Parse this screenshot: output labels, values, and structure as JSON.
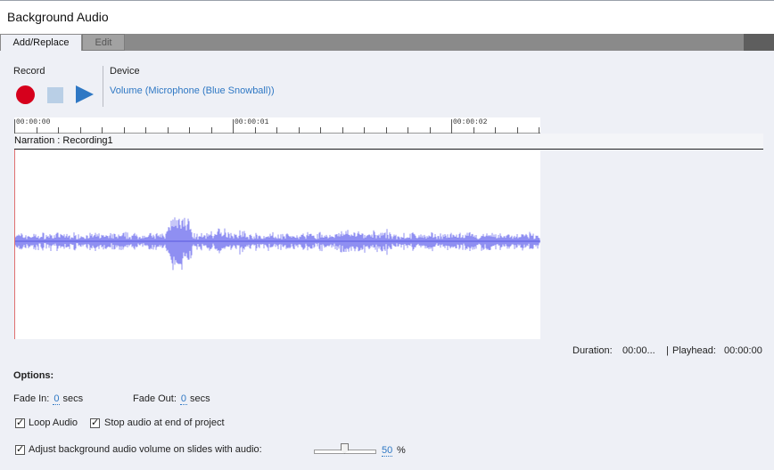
{
  "window": {
    "title": "Background Audio"
  },
  "tabs": [
    {
      "label": "Add/Replace",
      "active": true
    },
    {
      "label": "Edit",
      "active": false
    }
  ],
  "record": {
    "section_label": "Record",
    "buttons": {
      "record": "record-icon",
      "stop": "stop-icon",
      "play": "play-icon"
    }
  },
  "device": {
    "section_label": "Device",
    "value": "Volume (Microphone (Blue Snowball))"
  },
  "timeline": {
    "ruler_labels": [
      "00:00:00",
      "00:00:01",
      "00:00:02"
    ],
    "track_label": "Narration : Recording1",
    "waveform_color": "#8f8ff2"
  },
  "status": {
    "duration_label": "Duration:",
    "duration_value": "00:00...",
    "separator": "|",
    "playhead_label": "Playhead:",
    "playhead_value": "00:00:00"
  },
  "options": {
    "title": "Options:",
    "fade_in": {
      "label": "Fade In:",
      "value": "0",
      "unit": "secs"
    },
    "fade_out": {
      "label": "Fade Out:",
      "value": "0",
      "unit": "secs"
    },
    "loop_audio": {
      "label": "Loop Audio",
      "checked": true
    },
    "stop_audio": {
      "label": "Stop audio at end of project",
      "checked": true
    },
    "adjust_volume": {
      "label": "Adjust background audio volume on slides with audio:",
      "checked": true
    },
    "volume": {
      "value": "50",
      "unit": "%",
      "fraction": 0.5
    }
  },
  "colors": {
    "accent": "#2f78c4",
    "record": "#d6001c",
    "stop": "#b9cfe6",
    "playhead_line": "#e07070"
  }
}
